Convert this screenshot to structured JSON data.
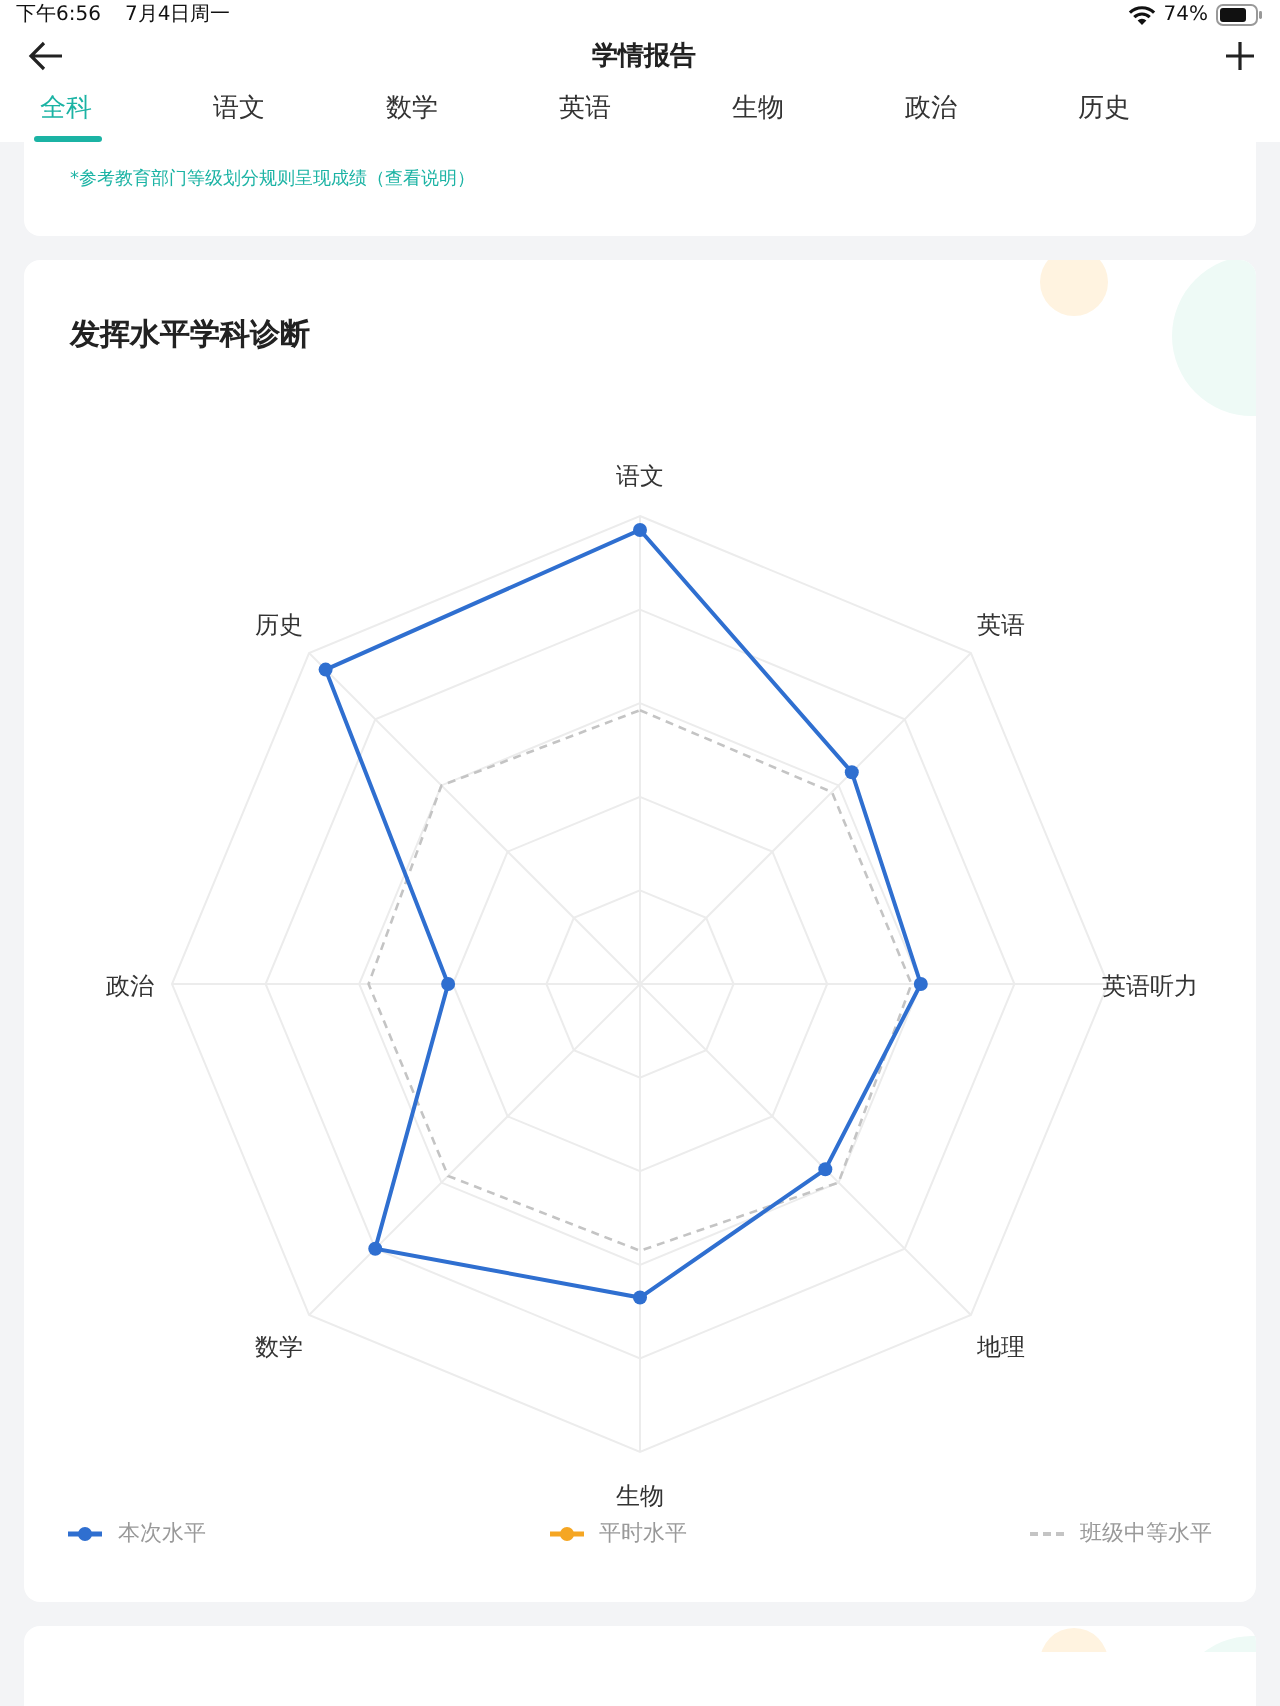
{
  "status_bar": {
    "time": "下午6:56",
    "date": "7月4日周一",
    "battery": "74%"
  },
  "nav": {
    "title": "学情报告"
  },
  "tabs": [
    {
      "label": "全科",
      "selected": true
    },
    {
      "label": "语文",
      "selected": false
    },
    {
      "label": "数学",
      "selected": false
    },
    {
      "label": "英语",
      "selected": false
    },
    {
      "label": "生物",
      "selected": false
    },
    {
      "label": "政治",
      "selected": false
    },
    {
      "label": "历史",
      "selected": false
    }
  ],
  "note": "*参考教育部门等级划分规则呈现成绩（查看说明）",
  "diagnosis": {
    "title": "发挥水平学科诊断",
    "axes": [
      "语文",
      "英语",
      "英语听力",
      "地理",
      "生物",
      "数学",
      "政治",
      "历史"
    ],
    "legend": [
      {
        "label": "本次水平",
        "color": "#2f6fd0",
        "kind": "line"
      },
      {
        "label": "平时水平",
        "color": "#f5a623",
        "kind": "line"
      },
      {
        "label": "班级中等水平",
        "color": "#c4c4c4",
        "kind": "dashed"
      }
    ]
  }
}
